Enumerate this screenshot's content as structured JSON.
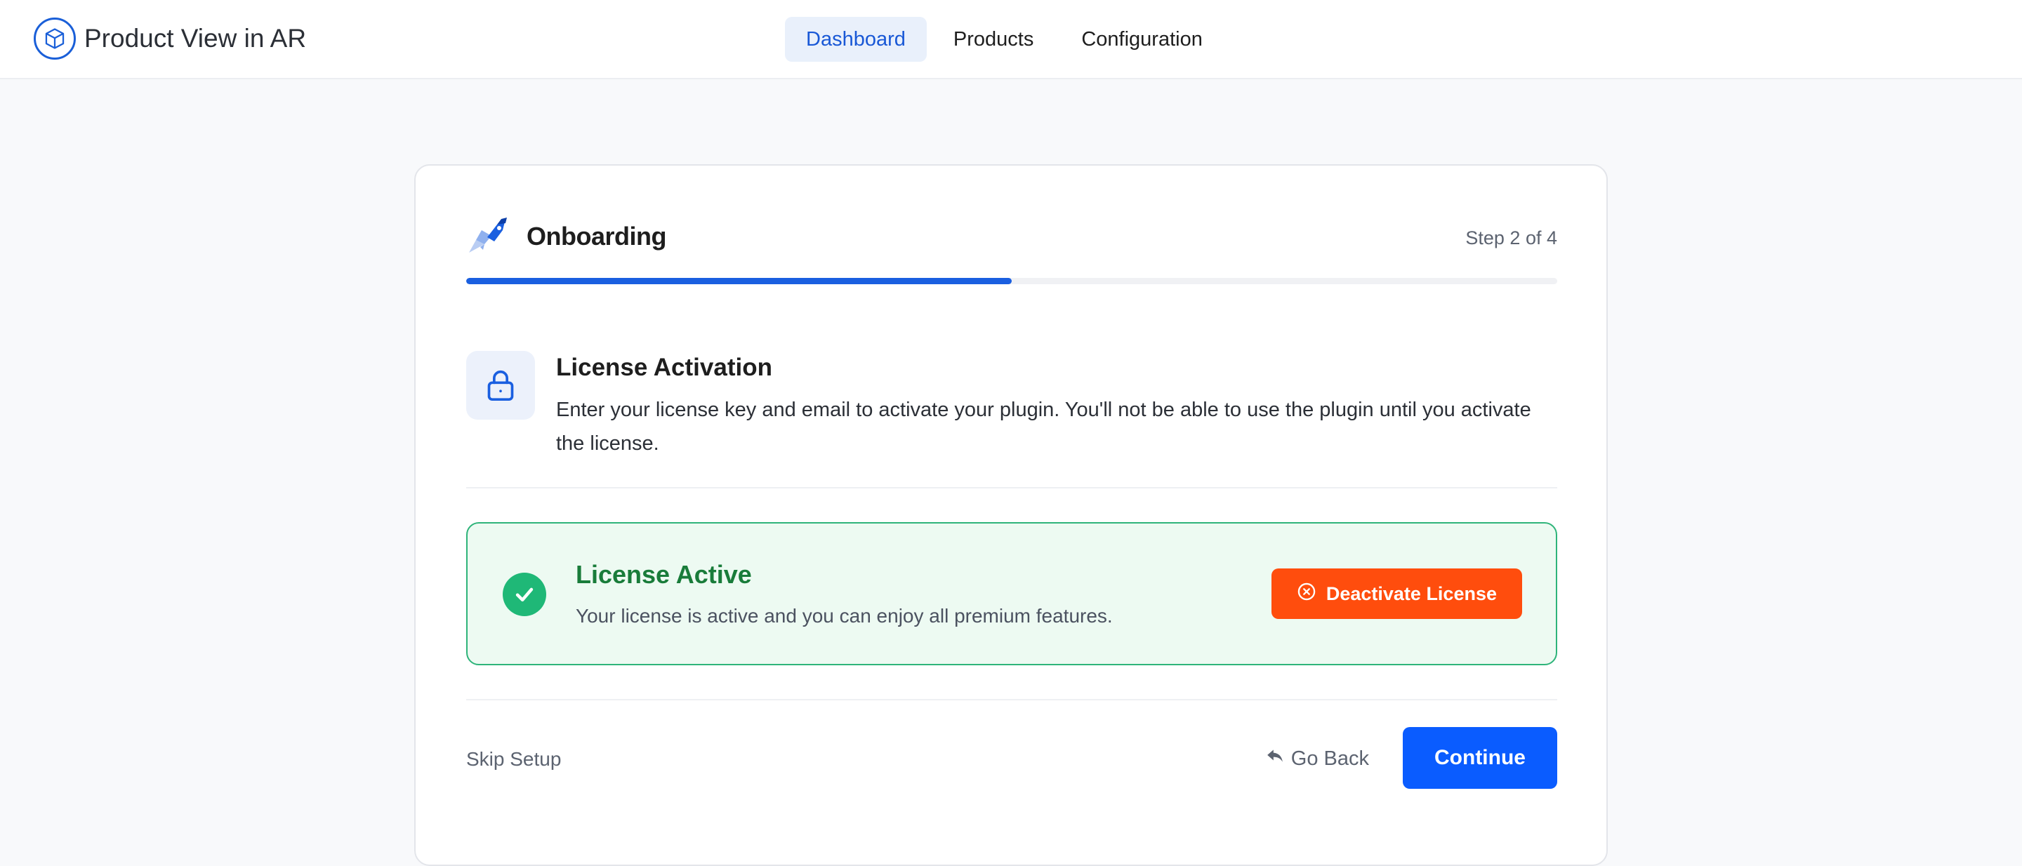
{
  "app": {
    "title": "Product View in AR",
    "logo_icon": "cube-icon"
  },
  "nav": {
    "tabs": [
      {
        "label": "Dashboard",
        "active": true
      },
      {
        "label": "Products",
        "active": false
      },
      {
        "label": "Configuration",
        "active": false
      }
    ]
  },
  "onboarding": {
    "title": "Onboarding",
    "icon": "rocket-icon",
    "step_text": "Step 2 of 4",
    "progress": 0.5
  },
  "section": {
    "icon": "lock-icon",
    "title": "License Activation",
    "description": "Enter your license key and email to activate your plugin. You'll not be able to use the plugin until you activate the license."
  },
  "license": {
    "status_icon": "check-icon",
    "title": "License Active",
    "description": "Your license is active and you can enjoy all premium features.",
    "deactivate_label": "Deactivate License",
    "deactivate_icon": "x-circle-icon"
  },
  "footer": {
    "skip_label": "Skip Setup",
    "back_label": "Go Back",
    "back_icon": "reply-arrow-icon",
    "continue_label": "Continue"
  },
  "colors": {
    "accent": "#0a5cff",
    "success": "#1fb877",
    "danger": "#ff4d0d"
  }
}
